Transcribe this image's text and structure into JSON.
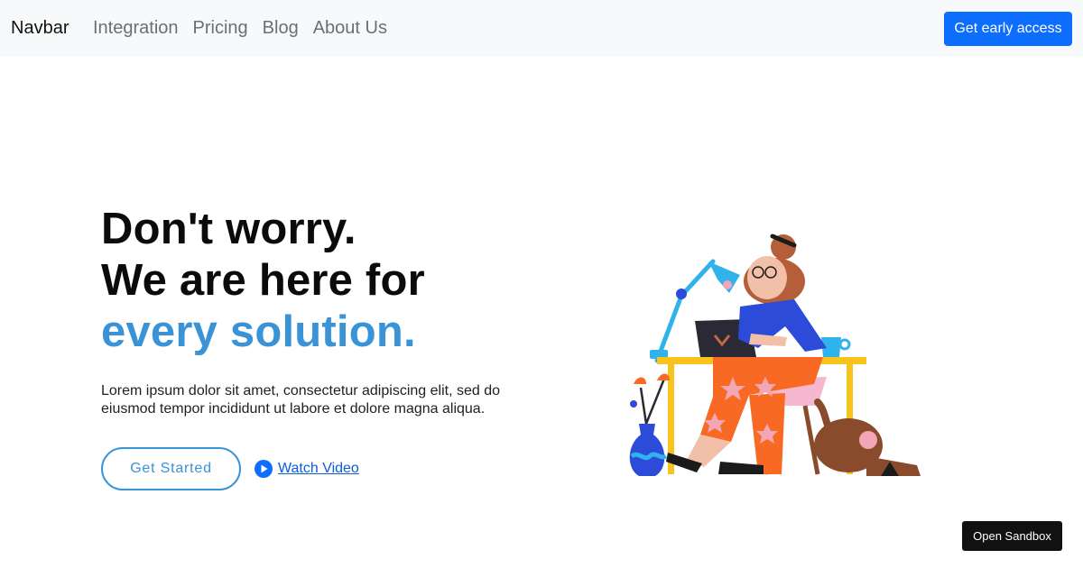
{
  "navbar": {
    "brand": "Navbar",
    "links": [
      "Integration",
      "Pricing",
      "Blog",
      "About Us"
    ],
    "cta": "Get early access"
  },
  "hero": {
    "title_line1": "Don't worry.",
    "title_line2": "We are here for",
    "title_line3": "every solution.",
    "description": "Lorem ipsum dolor sit amet, consectetur adipiscing elit, sed do eiusmod tempor incididunt ut labore et dolore magna aliqua.",
    "primary_button": "Get Started",
    "video_link": "Watch Video",
    "video_icon": "play-circle-icon"
  },
  "illustration": {
    "subject": "woman-working-at-desk-illustration"
  },
  "sandbox": {
    "label": "Open Sandbox"
  },
  "colors": {
    "primary": "#0d6efd",
    "accent": "#3a93d6",
    "navbar_bg": "#f8f9fa"
  }
}
